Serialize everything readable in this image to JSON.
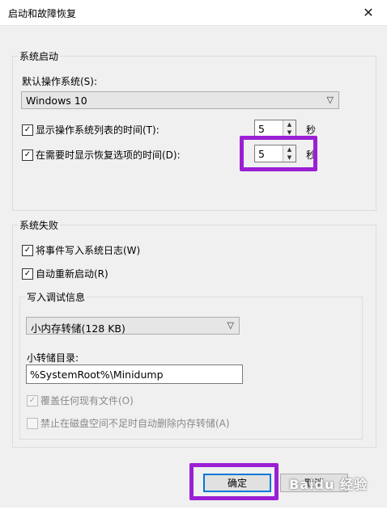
{
  "window": {
    "title": "启动和故障恢复",
    "close_glyph": "✕"
  },
  "system_startup": {
    "legend": "系统启动",
    "default_os_label": "默认操作系统(S):",
    "default_os_value": "Windows 10",
    "show_os_list": {
      "label": "显示操作系统列表的时间(T):",
      "checked": true,
      "value": "5",
      "unit": "秒"
    },
    "show_recovery": {
      "label": "在需要时显示恢复选项的时间(D):",
      "checked": true,
      "value": "5",
      "unit": "秒"
    }
  },
  "system_failure": {
    "legend": "系统失败",
    "write_event": {
      "label": "将事件写入系统日志(W)",
      "checked": true
    },
    "auto_restart": {
      "label": "自动重新启动(R)",
      "checked": true
    },
    "debug_info": {
      "legend": "写入调试信息",
      "type_value": "小内存转储(128 KB)",
      "dump_dir_label": "小转储目录:",
      "dump_dir_value": "%SystemRoot%\\Minidump",
      "overwrite": {
        "label": "覆盖任何现有文件(O)",
        "checked": true,
        "disabled": true
      },
      "disable_auto_delete": {
        "label": "禁止在磁盘空间不足时自动删除内存转储(A)",
        "checked": false,
        "disabled": true
      }
    }
  },
  "buttons": {
    "ok": "确定",
    "cancel": "取消"
  },
  "watermark": "Baidu 经验",
  "colors": {
    "highlight": "#9b1fd4",
    "focus": "#0078d7"
  }
}
